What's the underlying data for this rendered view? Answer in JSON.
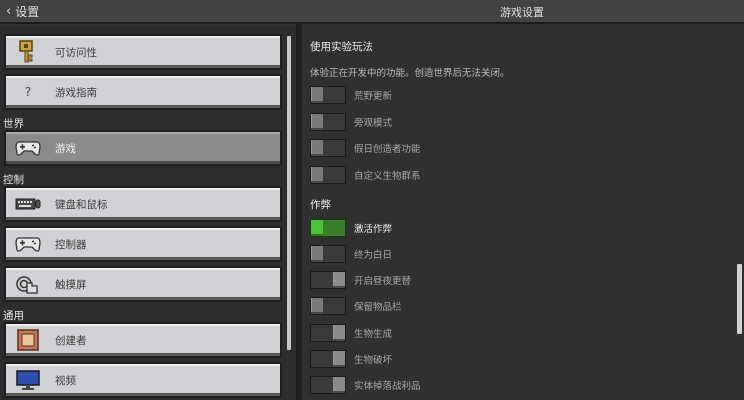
{
  "header": {
    "back_label": "设置",
    "title": "游戏设置"
  },
  "sidebar": {
    "items": [
      {
        "label": "可访问性",
        "icon": "key-icon"
      },
      {
        "label": "游戏指南",
        "icon": "question-icon"
      },
      {
        "label": "游戏",
        "icon": "controller-icon"
      },
      {
        "label": "键盘和鼠标",
        "icon": "keyboard-icon"
      },
      {
        "label": "控制器",
        "icon": "controller-icon"
      },
      {
        "label": "触摸屏",
        "icon": "touch-icon"
      },
      {
        "label": "创建者",
        "icon": "creator-icon"
      },
      {
        "label": "视频",
        "icon": "monitor-icon"
      }
    ],
    "sections": {
      "world": "世界",
      "controls": "控制",
      "general": "通用"
    },
    "selected": "游戏"
  },
  "main": {
    "experimental": {
      "heading": "使用实验玩法",
      "description": "体验正在开发中的功能。创造世界后无法关闭。",
      "toggles": [
        {
          "label": "荒野更新",
          "on": false
        },
        {
          "label": "旁观模式",
          "on": false
        },
        {
          "label": "假日创造者功能",
          "on": false
        },
        {
          "label": "自定义生物群系",
          "on": false
        }
      ]
    },
    "cheats": {
      "heading": "作弊",
      "toggles": [
        {
          "label": "激活作弊",
          "on": true
        },
        {
          "label": "终为白日",
          "on": false
        },
        {
          "label": "开启昼夜更替",
          "on": false
        },
        {
          "label": "保留物品栏",
          "on": false
        },
        {
          "label": "生物生成",
          "on": false
        },
        {
          "label": "生物破坏",
          "on": false
        },
        {
          "label": "实体掉落战利品",
          "on": false
        }
      ]
    }
  },
  "colors": {
    "accent_green": "#4ec03a",
    "button_bg": "#d0d1d4",
    "selected_bg": "#8b8b8b"
  }
}
